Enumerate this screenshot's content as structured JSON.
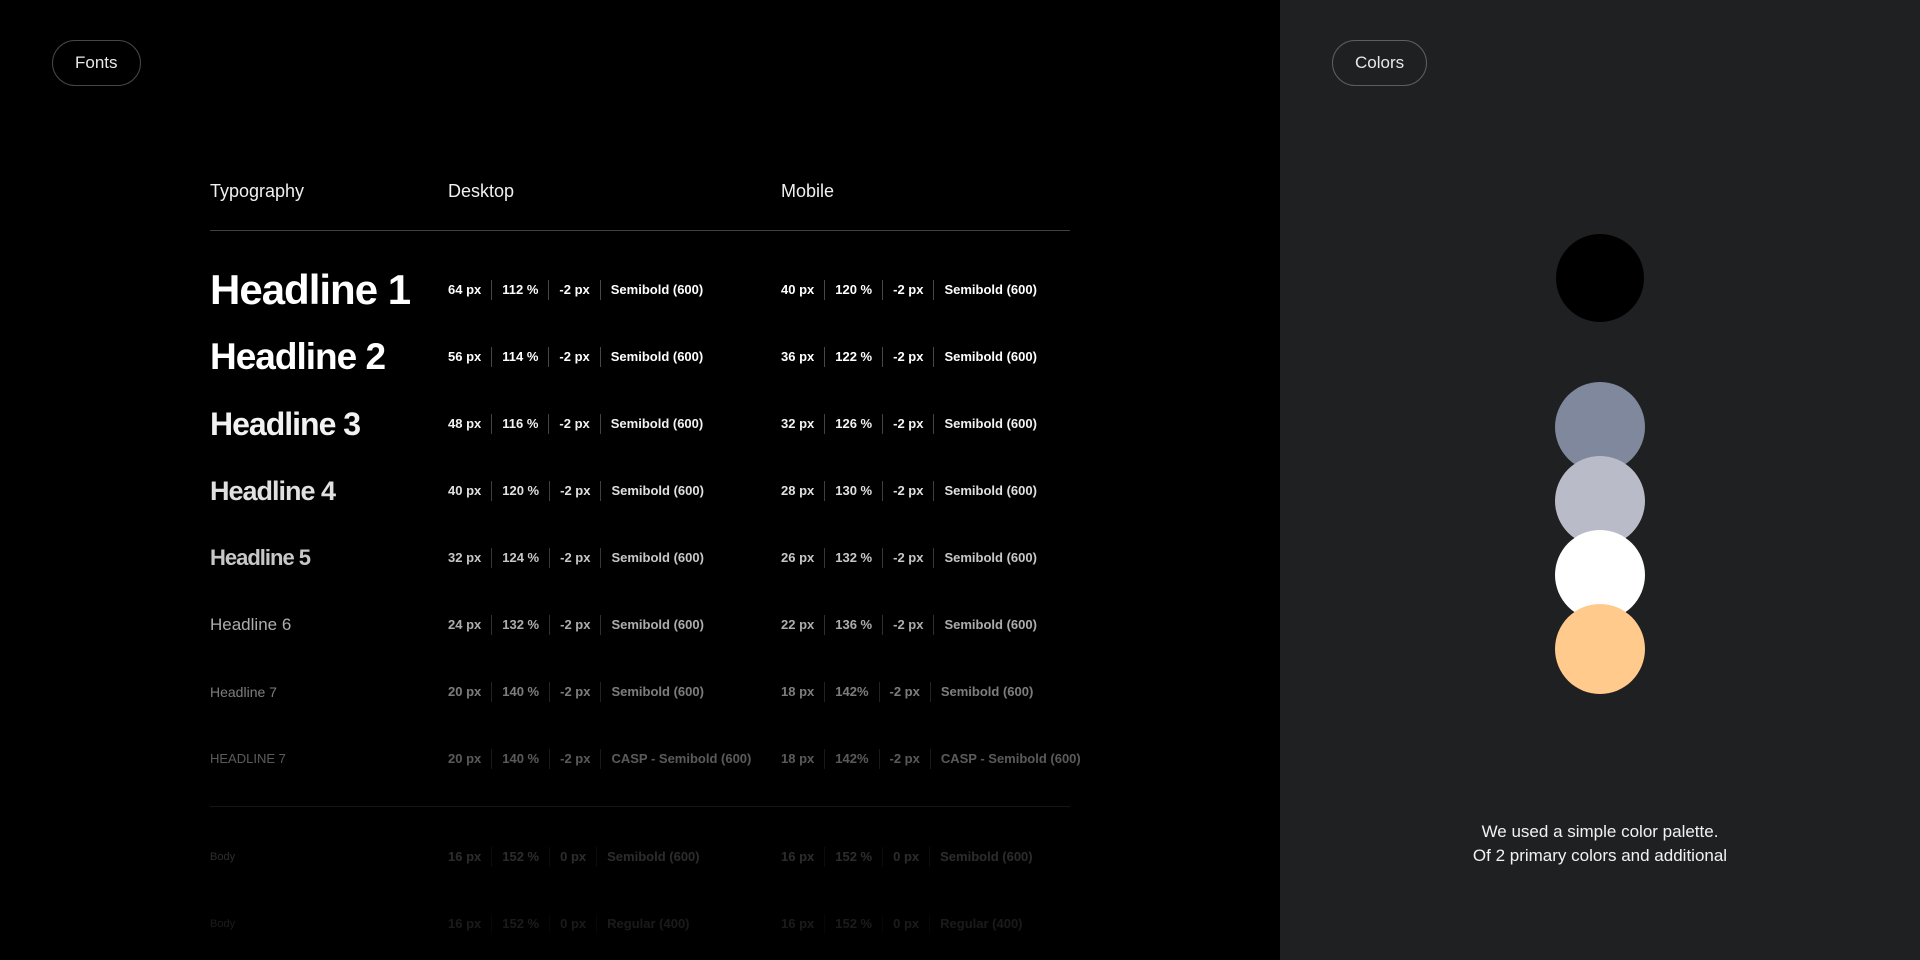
{
  "fonts_button": "Fonts",
  "colors_button": "Colors",
  "headers": {
    "typography": "Typography",
    "desktop": "Desktop",
    "mobile": "Mobile"
  },
  "rows": [
    {
      "name": "Headline 1",
      "desktop": [
        "64 px",
        "112 %",
        "-2 px",
        "Semibold (600)"
      ],
      "mobile": [
        "40 px",
        "120 %",
        "-2 px",
        "Semibold (600)"
      ]
    },
    {
      "name": "Headline 2",
      "desktop": [
        "56 px",
        "114 %",
        "-2 px",
        "Semibold (600)"
      ],
      "mobile": [
        "36 px",
        "122 %",
        "-2 px",
        "Semibold (600)"
      ]
    },
    {
      "name": "Headline 3",
      "desktop": [
        "48 px",
        "116 %",
        "-2 px",
        "Semibold (600)"
      ],
      "mobile": [
        "32 px",
        "126 %",
        "-2 px",
        "Semibold (600)"
      ]
    },
    {
      "name": "Headline 4",
      "desktop": [
        "40 px",
        "120 %",
        "-2 px",
        "Semibold (600)"
      ],
      "mobile": [
        "28 px",
        "130 %",
        "-2 px",
        "Semibold (600)"
      ]
    },
    {
      "name": "Headline 5",
      "desktop": [
        "32 px",
        "124 %",
        "-2 px",
        "Semibold (600)"
      ],
      "mobile": [
        "26 px",
        "132 %",
        "-2 px",
        "Semibold (600)"
      ]
    },
    {
      "name": "Headline 6",
      "desktop": [
        "24 px",
        "132 %",
        "-2 px",
        "Semibold (600)"
      ],
      "mobile": [
        "22 px",
        "136 %",
        "-2 px",
        "Semibold (600)"
      ]
    },
    {
      "name": "Headline 7",
      "desktop": [
        "20 px",
        "140 %",
        "-2 px",
        "Semibold (600)"
      ],
      "mobile": [
        "18 px",
        "142%",
        "-2 px",
        "Semibold (600)"
      ]
    },
    {
      "name": "HEADLINE 7",
      "desktop": [
        "20 px",
        "140 %",
        "-2 px",
        "CASP - Semibold (600)"
      ],
      "mobile": [
        "18 px",
        "142%",
        "-2 px",
        "CASP - Semibold (600)"
      ]
    },
    {
      "name": "Body",
      "desktop": [
        "16 px",
        "152 %",
        "0 px",
        "Semibold (600)"
      ],
      "mobile": [
        "16 px",
        "152 %",
        "0 px",
        "Semibold (600)"
      ]
    },
    {
      "name": "Body",
      "desktop": [
        "16 px",
        "152 %",
        "0 px",
        "Regular (400)"
      ],
      "mobile": [
        "16 px",
        "152 %",
        "0 px",
        "Regular (400)"
      ]
    }
  ],
  "palette": [
    "#000000",
    "#7f889c",
    "#b9bcc8",
    "#ffffff",
    "#ffca8c"
  ],
  "caption": {
    "line1": "We used a simple color palette.",
    "line2": "Of 2 primary colors and additional"
  }
}
